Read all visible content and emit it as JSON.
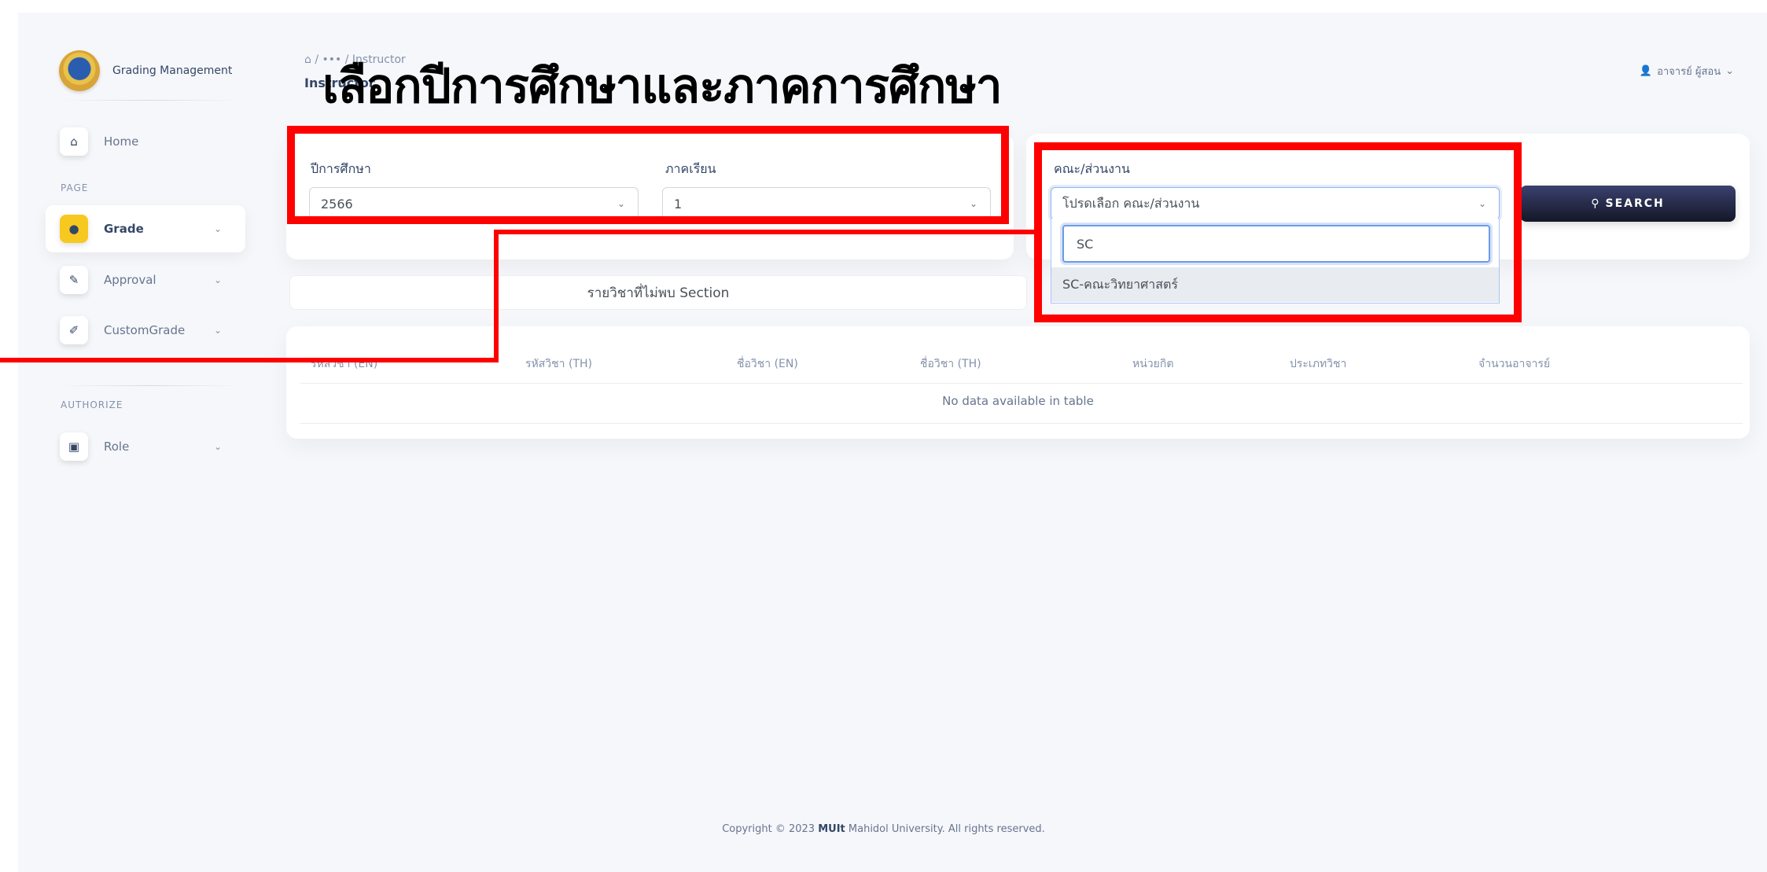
{
  "sidebar": {
    "brand": "Grading Management",
    "sections": {
      "page": "PAGE",
      "authorize": "AUTHORIZE"
    },
    "items": [
      {
        "label": "Home",
        "icon": "home-icon"
      },
      {
        "label": "Grade",
        "icon": "grade-icon",
        "active": true
      },
      {
        "label": "Approval",
        "icon": "approval-icon"
      },
      {
        "label": "CustomGrade",
        "icon": "edit-icon"
      },
      {
        "label": "Role",
        "icon": "role-icon"
      }
    ]
  },
  "header": {
    "breadcrumb": "⌂ / ••• / Instructor",
    "page_title": "Instructor",
    "overlay_title": "เลือกปีการศึกษาและภาคการศึกษา",
    "user_name": "อาจารย์ ผู้สอน"
  },
  "filters": {
    "year_label": "ปีการศึกษา",
    "year_value": "2566",
    "semester_label": "ภาคเรียน",
    "semester_value": "1",
    "faculty_label": "คณะ/ส่วนงาน",
    "faculty_placeholder": "โปรดเลือก คณะ/ส่วนงาน",
    "dropdown_search_value": "SC",
    "dropdown_option": "SC-คณะวิทยาศาสตร์",
    "search_button": "SEARCH"
  },
  "tab": {
    "label": "รายวิชาที่ไม่พบ Section"
  },
  "table": {
    "headers": [
      "รหัสวิชา (EN)",
      "รหัสวิชา (TH)",
      "ชื่อวิชา (EN)",
      "ชื่อวิชา (TH)",
      "หน่วยกิต",
      "ประเภทวิชา",
      "จำนวนอาจารย์"
    ],
    "empty_text": "No data available in table"
  },
  "footer": {
    "prefix": "Copyright © 2023",
    "brand": "MUIt",
    "suffix": "Mahidol University. All rights reserved."
  },
  "colors": {
    "annotation": "#ff0000",
    "accent": "#f7c81f",
    "button": "#1f2540",
    "background": "#f6f7fb"
  }
}
